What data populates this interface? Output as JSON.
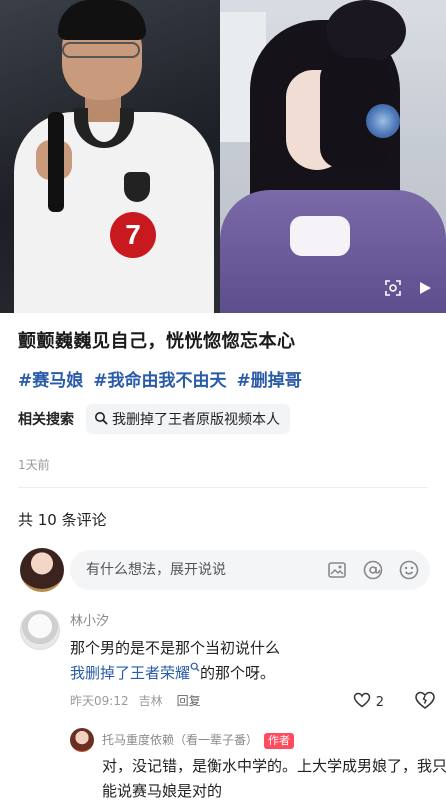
{
  "post": {
    "title": "颤颤巍巍见自己，恍恍惚惚忘本心",
    "tags": [
      "#赛马娘",
      "#我命由我不由天",
      "#删掉哥"
    ],
    "related_label": "相关搜索",
    "related_query": "我删掉了王者原版视频本人",
    "timestamp": "1天前",
    "badge_number": "7"
  },
  "comments_header": {
    "count_text": "共 10 条评论"
  },
  "comment_input": {
    "placeholder": "有什么想法，展开说说"
  },
  "comment": {
    "username": "林小汐",
    "text_before_link": "那个男的是不是那个当初说什么",
    "link_text": "我删掉了王者荣耀",
    "text_after_link": "的那个呀。",
    "time": "昨天09:12",
    "location": "吉林",
    "reply_label": "回复",
    "like_count": "2"
  },
  "reply": {
    "username": "托马重度依赖（看一辈子番）",
    "author_badge": "作者",
    "text": "对，没记错，是衡水中学的。上大学成男娘了，我只能说赛马娘是对的"
  },
  "colors": {
    "link_blue": "#2a5ba8",
    "author_badge_red": "#ff4b5c",
    "badge_red": "#c8191f"
  },
  "icons": [
    "search-icon",
    "image-icon",
    "at-icon",
    "emoji-icon",
    "heart-icon",
    "dislike-icon",
    "lens-icon",
    "play-icon"
  ]
}
